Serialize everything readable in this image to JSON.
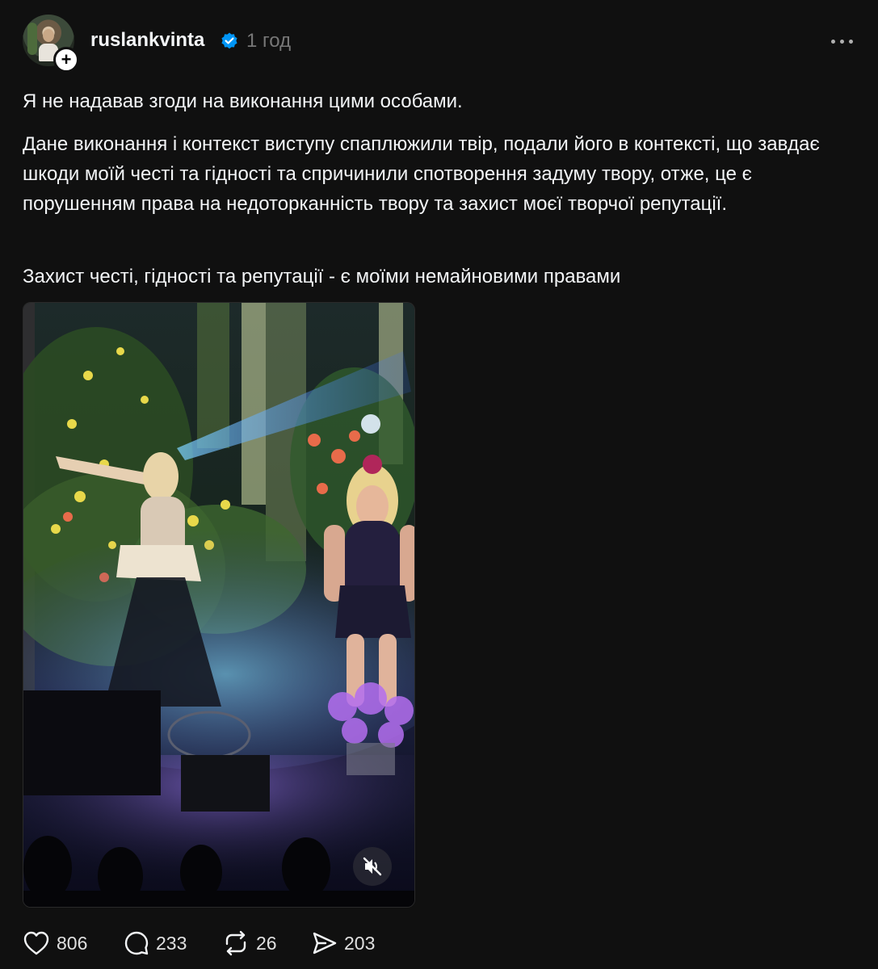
{
  "post": {
    "author": {
      "username": "ruslankvinta",
      "verified": true,
      "avatar_icon": "avatar-photo",
      "follow_badge": "+"
    },
    "timestamp": "1 год",
    "paragraphs": [
      "Я не надавав згоди на виконання цими особами.",
      "Дане виконання і контекст виступу спаплюжили твір, подали його в контексті, що завдає шкоди моїй честі та гідності та спричинили спотворення задуму твору, отже, це є порушенням права на недоторканність твору та захист моєї творчої репутації.",
      "Захист честі, гідності та репутації - є моїми немайновими правами"
    ],
    "media": {
      "type": "video",
      "muted": true
    },
    "actions": {
      "likes": "806",
      "comments": "233",
      "reposts": "26",
      "shares": "203"
    }
  },
  "colors": {
    "background": "#101010",
    "text": "#f3f5f7",
    "muted_text": "#777777",
    "verified_blue": "#0095f6"
  }
}
